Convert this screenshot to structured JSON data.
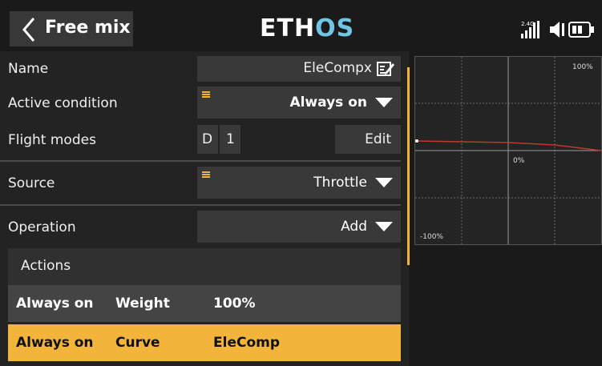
{
  "header": {
    "back_icon": "chevron-left-icon",
    "title": "Free mix",
    "logo_main": "ETH",
    "logo_accent": "OS",
    "status_icons": [
      "signal-2.4g-icon",
      "speaker-icon",
      "battery-icon"
    ],
    "signal_label": "2.4G"
  },
  "form": {
    "name": {
      "label": "Name",
      "value": "EleCompx",
      "edit_icon": "edit-icon"
    },
    "active_condition": {
      "label": "Active condition",
      "value": "Always on"
    },
    "flight_modes": {
      "label": "Flight modes",
      "modes": [
        "D",
        "1"
      ],
      "edit_label": "Edit"
    },
    "source": {
      "label": "Source",
      "value": "Throttle"
    },
    "operation": {
      "label": "Operation",
      "value": "Add"
    }
  },
  "graph": {
    "label_top": "100%",
    "label_mid": "0%",
    "label_bottom": "-100%",
    "curve_color": "#c0392b"
  },
  "actions": {
    "header": "Actions",
    "rows": [
      {
        "condition": "Always on",
        "type": "Weight",
        "value": "100%",
        "selected": false
      },
      {
        "condition": "Always on",
        "type": "Curve",
        "value": "EleComp",
        "selected": true
      }
    ]
  },
  "colors": {
    "accent": "#f2b43a",
    "background": "#1a1a1a",
    "field": "#393939"
  }
}
